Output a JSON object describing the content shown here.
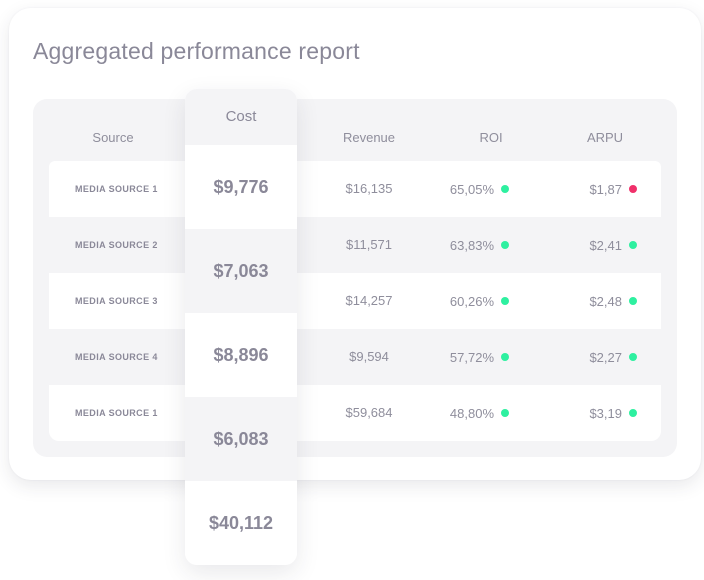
{
  "report": {
    "title": "Aggregated performance report",
    "columns": {
      "source": "Source",
      "cost": "Cost",
      "revenue": "Revenue",
      "roi": "ROI",
      "arpu": "ARPU"
    },
    "status_colors": {
      "good": "#2ef0a0",
      "bad": "#f0306a"
    },
    "rows": [
      {
        "source": "MEDIA SOURCE 1",
        "revenue": "$16,135",
        "roi": "65,05%",
        "roi_status": "good",
        "arpu": "$1,87",
        "arpu_status": "bad"
      },
      {
        "source": "MEDIA SOURCE 2",
        "revenue": "$11,571",
        "roi": "63,83%",
        "roi_status": "good",
        "arpu": "$2,41",
        "arpu_status": "good"
      },
      {
        "source": "MEDIA SOURCE 3",
        "revenue": "$14,257",
        "roi": "60,26%",
        "roi_status": "good",
        "arpu": "$2,48",
        "arpu_status": "good"
      },
      {
        "source": "MEDIA SOURCE 4",
        "revenue": "$9,594",
        "roi": "57,72%",
        "roi_status": "good",
        "arpu": "$2,27",
        "arpu_status": "good"
      },
      {
        "source": "MEDIA SOURCE 1",
        "revenue": "$59,684",
        "roi": "48,80%",
        "roi_status": "good",
        "arpu": "$3,19",
        "arpu_status": "good"
      }
    ],
    "cost_values": [
      "$9,776",
      "$7,063",
      "$8,896",
      "$6,083"
    ],
    "cost_total": "$40,112"
  }
}
